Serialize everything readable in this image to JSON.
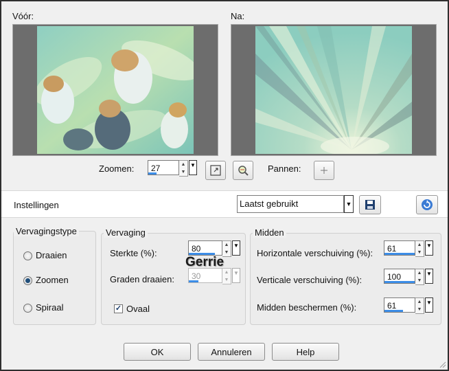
{
  "preview": {
    "before_label": "Vóór:",
    "after_label": "Na:"
  },
  "zoom": {
    "label": "Zoomen:",
    "value": "27",
    "pan_label": "Pannen:"
  },
  "settings": {
    "label": "Instellingen",
    "preset_value": "Laatst gebruikt"
  },
  "blur_type": {
    "title": "Vervagingstype",
    "options": [
      {
        "label": "Draaien",
        "selected": false
      },
      {
        "label": "Zoomen",
        "selected": true
      },
      {
        "label": "Spiraal",
        "selected": false
      }
    ]
  },
  "blur": {
    "title": "Vervaging",
    "strength_label": "Sterkte (%):",
    "strength_value": "80",
    "rotate_label": "Graden draaien:",
    "rotate_value": "30",
    "oval_label": "Ovaal",
    "oval_checked": true,
    "watermark": "Gerrie"
  },
  "center": {
    "title": "Midden",
    "h_label": "Horizontale verschuiving (%):",
    "h_value": "61",
    "v_label": "Verticale verschuiving (%):",
    "v_value": "100",
    "protect_label": "Midden beschermen (%):",
    "protect_value": "61"
  },
  "buttons": {
    "ok": "OK",
    "cancel": "Annuleren",
    "help": "Help"
  },
  "colors": {
    "accent": "#3d8ee8",
    "preview_bg": "#6d6d6d"
  }
}
